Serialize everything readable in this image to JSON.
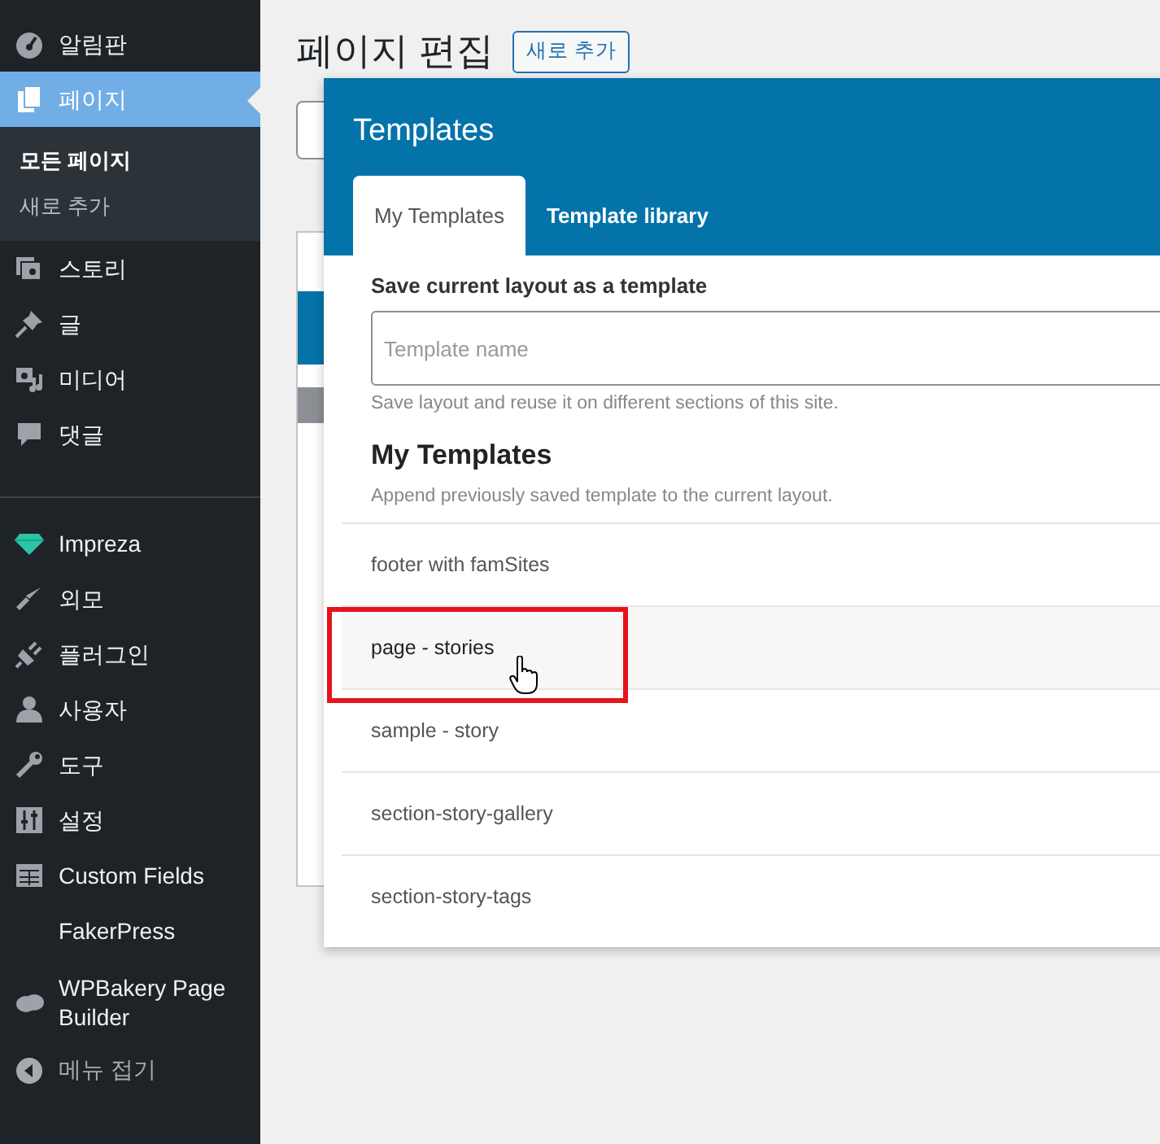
{
  "sidebar": {
    "groups": [
      [
        {
          "label": "알림판",
          "selected": false
        },
        {
          "label": "페이지",
          "selected": true,
          "submenu": [
            {
              "label": "모든 페이지",
              "selected": true
            },
            {
              "label": "새로 추가",
              "selected": false
            }
          ]
        },
        {
          "label": "스토리",
          "selected": false
        },
        {
          "label": "글",
          "selected": false
        },
        {
          "label": "미디어",
          "selected": false
        },
        {
          "label": "댓글",
          "selected": false
        }
      ],
      [
        {
          "label": "Impreza",
          "selected": false
        },
        {
          "label": "외모",
          "selected": false
        },
        {
          "label": "플러그인",
          "selected": false
        },
        {
          "label": "사용자",
          "selected": false
        },
        {
          "label": "도구",
          "selected": false
        },
        {
          "label": "설정",
          "selected": false
        },
        {
          "label": "Custom Fields",
          "selected": false
        },
        {
          "label": "FakerPress",
          "selected": false
        },
        {
          "label": "WPBakery Page Builder",
          "selected": false
        }
      ]
    ],
    "collapse_label": "메뉴 접기"
  },
  "page": {
    "title": "페이지 편집",
    "add_new_button": "새로 추가"
  },
  "modal": {
    "title": "Templates",
    "tabs": [
      {
        "label": "My Templates",
        "selected": true
      },
      {
        "label": "Template library",
        "selected": false
      }
    ],
    "save_heading": "Save current layout as a template",
    "name_field": {
      "placeholder": "Template name"
    },
    "save_help": "Save layout and reuse it on different sections of this site.",
    "list_heading": "My Templates",
    "list_help": "Append previously saved template to the current layout.",
    "templates": [
      {
        "name": "footer with famSites",
        "highlighted": false
      },
      {
        "name": "page - stories",
        "highlighted": true
      },
      {
        "name": "sample - story",
        "highlighted": false
      },
      {
        "name": "section-story-gallery",
        "highlighted": false
      },
      {
        "name": "section-story-tags",
        "highlighted": false
      }
    ]
  }
}
